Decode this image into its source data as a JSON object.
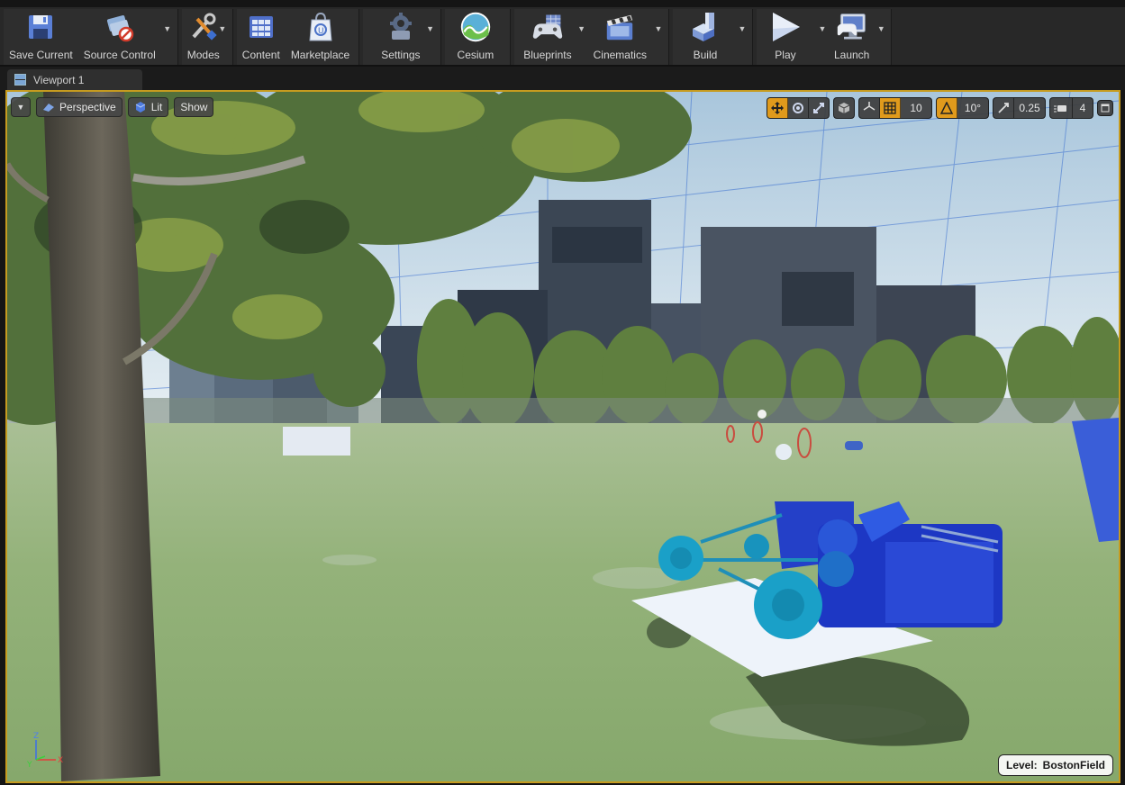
{
  "toolbar": {
    "buttons": [
      {
        "id": "save_current",
        "label": "Save Current"
      },
      {
        "id": "source_control",
        "label": "Source Control"
      },
      {
        "id": "modes",
        "label": "Modes"
      },
      {
        "id": "content",
        "label": "Content"
      },
      {
        "id": "marketplace",
        "label": "Marketplace"
      },
      {
        "id": "settings",
        "label": "Settings"
      },
      {
        "id": "cesium",
        "label": "Cesium"
      },
      {
        "id": "blueprints",
        "label": "Blueprints"
      },
      {
        "id": "cinematics",
        "label": "Cinematics"
      },
      {
        "id": "build",
        "label": "Build"
      },
      {
        "id": "play",
        "label": "Play"
      },
      {
        "id": "launch",
        "label": "Launch"
      }
    ]
  },
  "tabs": [
    {
      "label": "Viewport 1"
    }
  ],
  "viewport": {
    "left_controls": {
      "view_mode": "Perspective",
      "lighting": "Lit",
      "show": "Show"
    },
    "right_controls": {
      "grid_snap": "10",
      "rotation_snap": "10°",
      "scale_snap": "0.25",
      "camera_speed": "4"
    },
    "level": {
      "label": "Level:",
      "name": "BostonField"
    },
    "axis": {
      "z": "Z",
      "x": "X",
      "y": "Y"
    }
  },
  "colors": {
    "accent_orange": "#e09a1c",
    "viewport_border": "#c69b1f",
    "vehicle_blue": "#1f3fc9",
    "wheel_teal": "#1aa0c8"
  }
}
